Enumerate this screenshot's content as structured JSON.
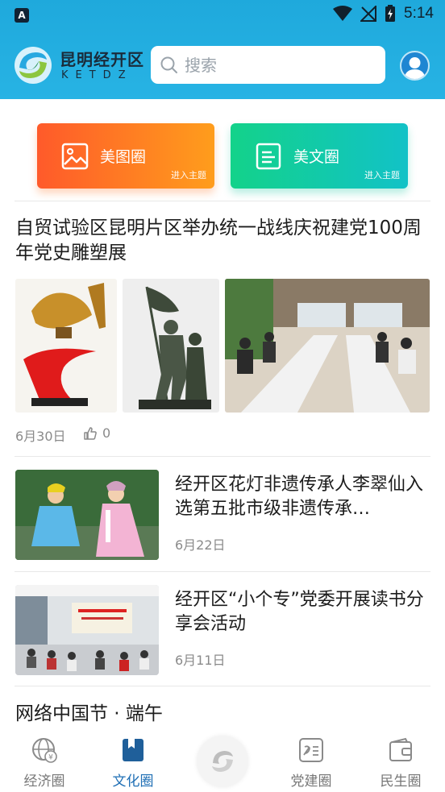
{
  "status_bar": {
    "left_badge": "A",
    "time": "5:14"
  },
  "header": {
    "brand_name": "昆明经开区",
    "brand_sub": "KETDZ",
    "search_placeholder": "搜索"
  },
  "tiles": [
    {
      "label": "美图圈",
      "sub": "进入主题"
    },
    {
      "label": "美文圈",
      "sub": "进入主题"
    }
  ],
  "feature_article": {
    "title": "自贸试验区昆明片区举办统一战线庆祝建党100周年党史雕塑展",
    "date": "6月30日",
    "likes": "0"
  },
  "articles": [
    {
      "title": "经开区花灯非遗传承人李翠仙入选第五批市级非遗传承…",
      "date": "6月22日"
    },
    {
      "title": "经开区“小个专”党委开展读书分享会活动",
      "date": "6月11日"
    }
  ],
  "partial_article": {
    "title": "网络中国节 · 端午"
  },
  "bottom_nav": [
    {
      "label": "经济圈",
      "icon": "globe-icon",
      "active": false
    },
    {
      "label": "文化圈",
      "icon": "bookmark-book-icon",
      "active": true
    },
    {
      "label": "党建圈",
      "icon": "party-badge-icon",
      "active": false
    },
    {
      "label": "民生圈",
      "icon": "wallet-icon",
      "active": false
    }
  ],
  "colors": {
    "header": "#27b3e4",
    "tile_orange": "#ff5a2a",
    "tile_green": "#13d28a",
    "nav_active": "#1f6fb5"
  }
}
